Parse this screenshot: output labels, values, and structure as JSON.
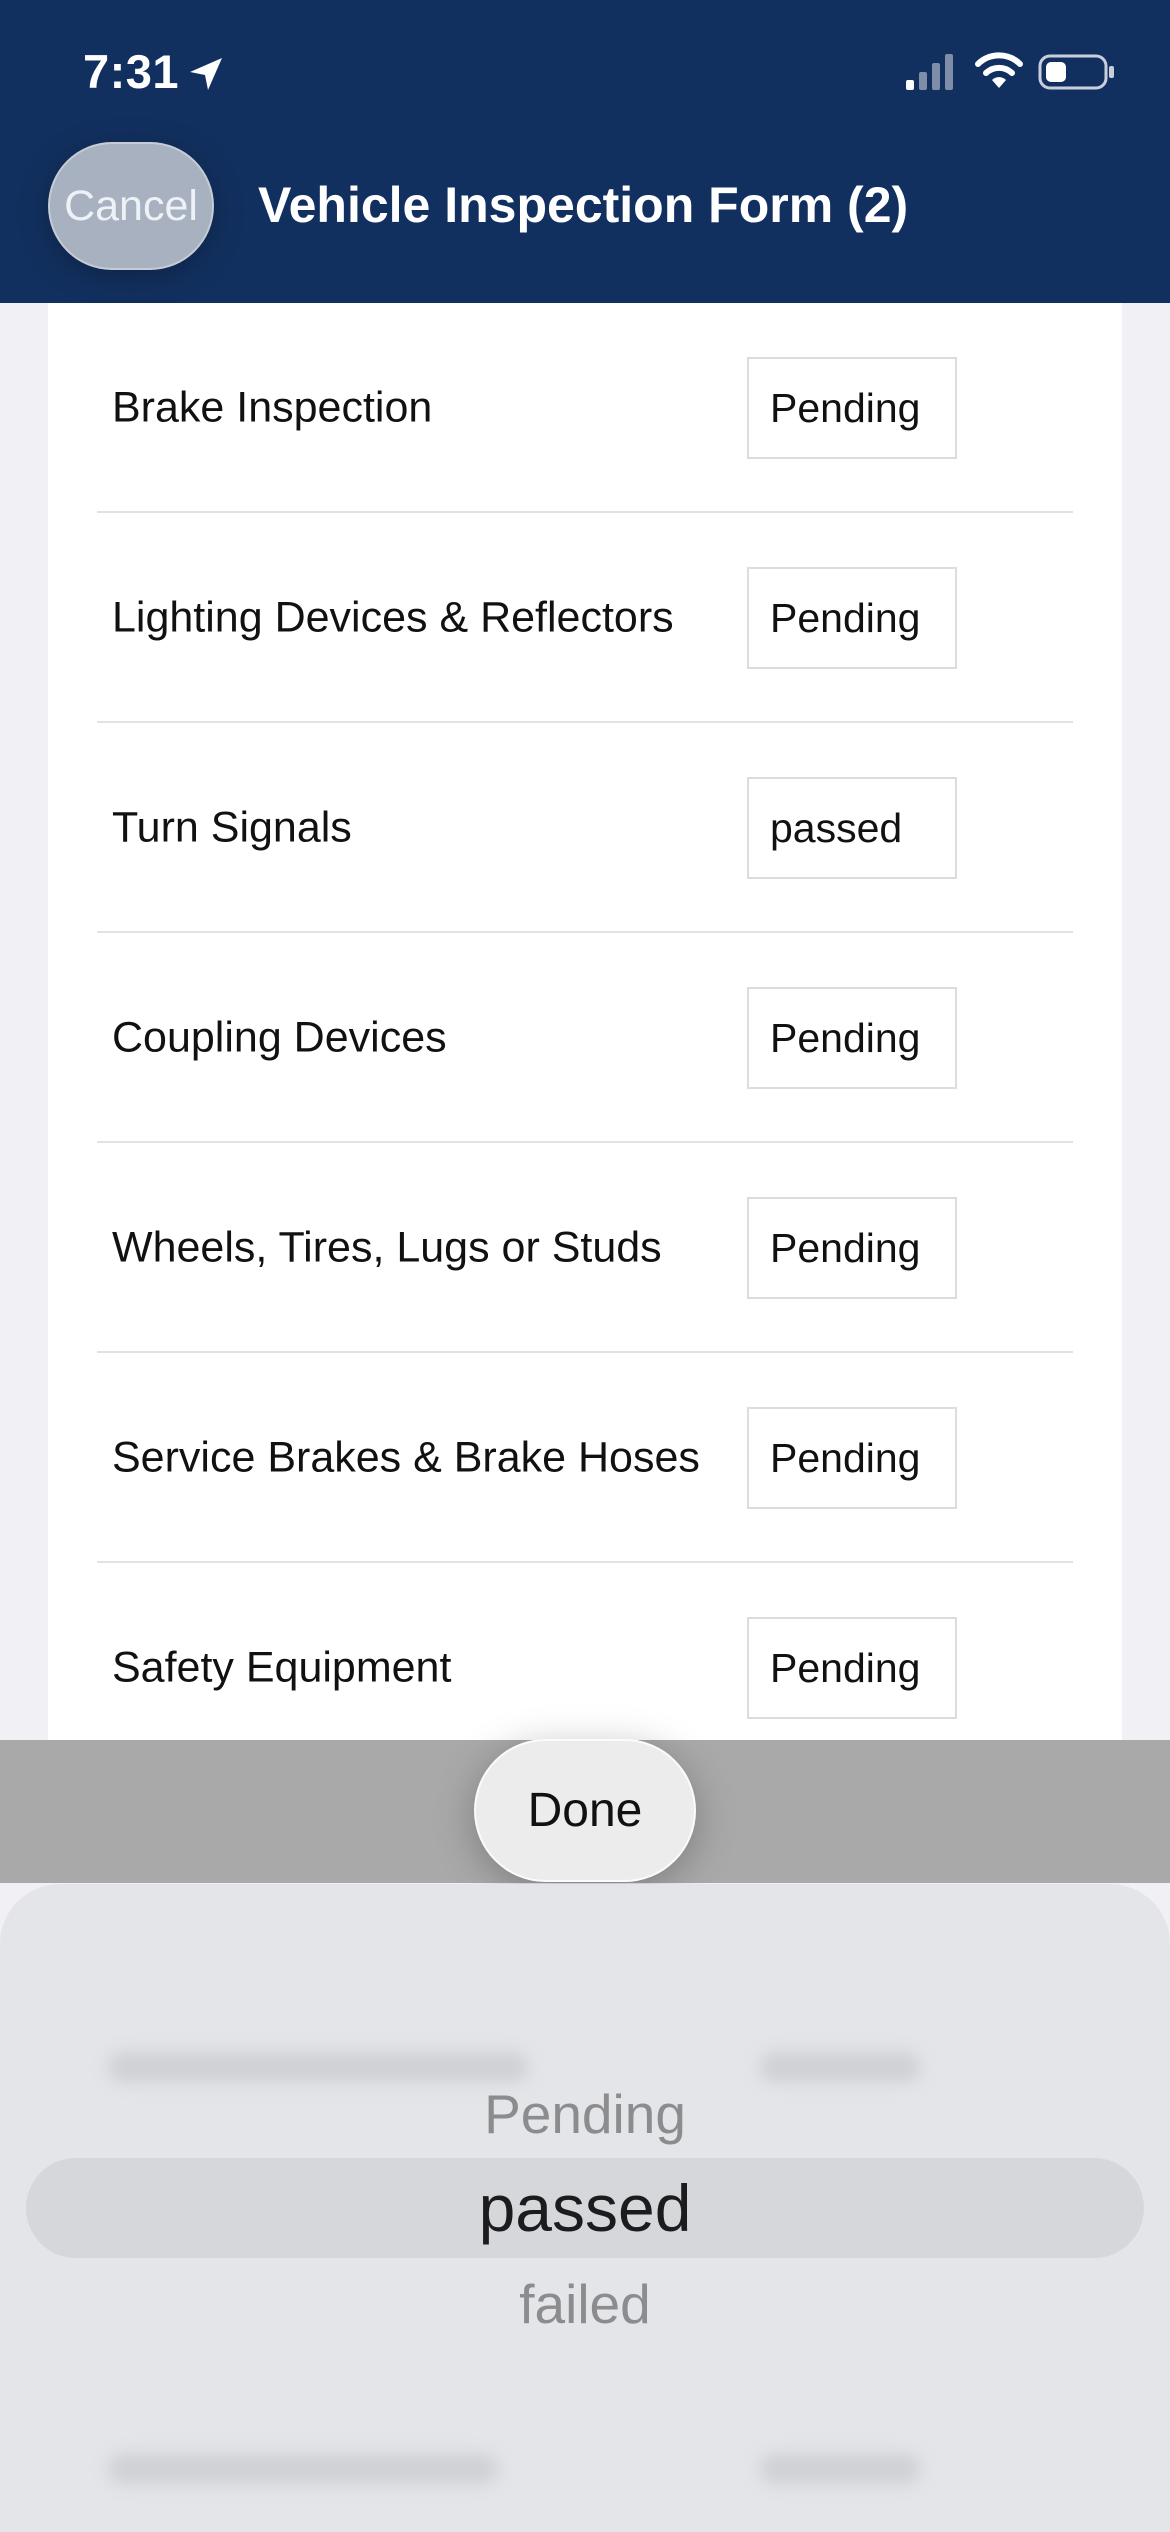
{
  "status_bar": {
    "time": "7:31",
    "icons": [
      "location-arrow-icon",
      "cellular-signal-icon",
      "wifi-icon",
      "battery-icon"
    ]
  },
  "header": {
    "cancel_label": "Cancel",
    "title": "Vehicle Inspection Form (2)",
    "background_color": "#12305f"
  },
  "inspection_items": [
    {
      "label": "Brake Inspection",
      "value": "Pending"
    },
    {
      "label": "Lighting Devices & Reflectors",
      "value": "Pending"
    },
    {
      "label": "Turn Signals",
      "value": "passed"
    },
    {
      "label": "Coupling Devices",
      "value": "Pending"
    },
    {
      "label": "Wheels, Tires, Lugs or Studs",
      "value": "Pending"
    },
    {
      "label": "Service Brakes & Brake Hoses",
      "value": "Pending"
    },
    {
      "label": "Safety Equipment",
      "value": "Pending"
    }
  ],
  "toolbar": {
    "done_label": "Done"
  },
  "picker": {
    "options": [
      "Pending",
      "passed",
      "failed"
    ],
    "selected": "passed"
  }
}
